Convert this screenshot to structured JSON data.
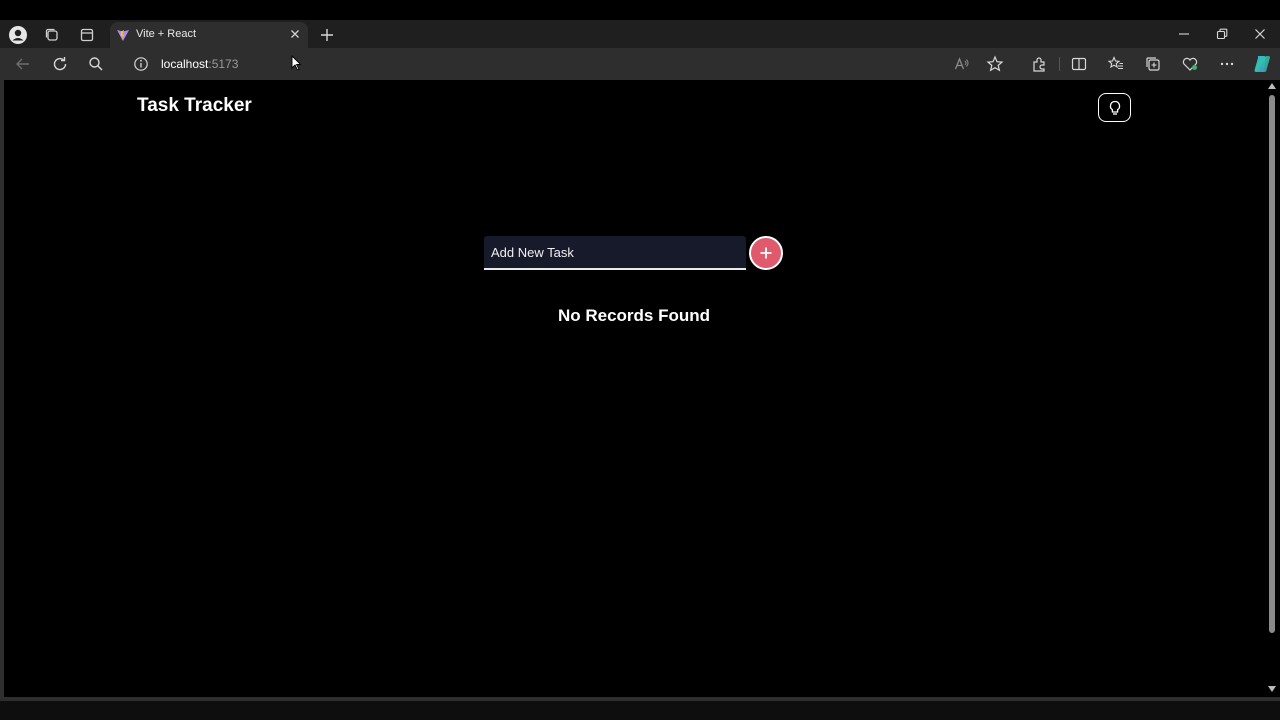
{
  "browser": {
    "tab": {
      "title": "Vite + React"
    },
    "address": {
      "host": "localhost",
      "port": ":5173"
    },
    "colors": {
      "tab_bar": "#1f1f1f",
      "toolbar": "#2e2e2e"
    }
  },
  "app": {
    "title": "Task Tracker",
    "theme_toggle_icon": "lightbulb-icon",
    "task_input": {
      "placeholder": "Add New Task",
      "value": ""
    },
    "add_button_icon": "plus-icon",
    "empty_message": "No Records Found",
    "colors": {
      "background": "#000000",
      "accent": "#e05a6d",
      "input_bg": "#171a2b"
    }
  }
}
